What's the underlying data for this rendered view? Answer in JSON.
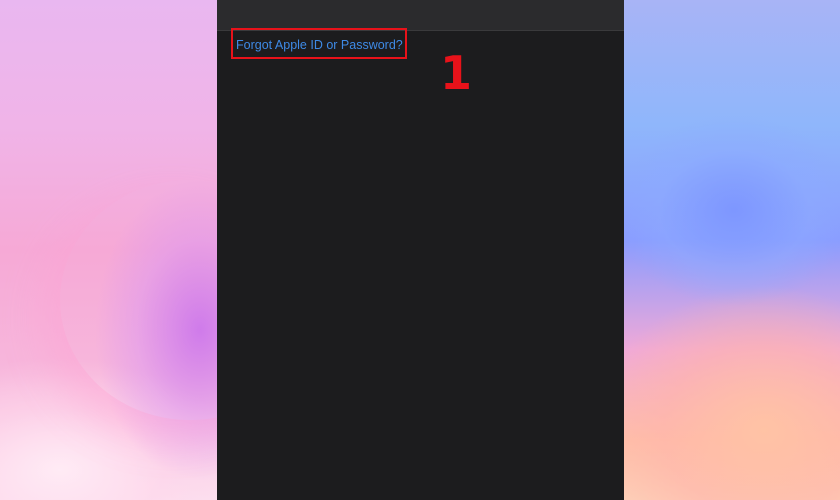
{
  "login_panel": {
    "forgot_link_label": "Forgot Apple ID or Password?"
  },
  "annotation": {
    "step_label": "1",
    "color": "#e8121a"
  },
  "colors": {
    "panel_background": "#1c1c1e",
    "top_bar_background": "#2b2b2d",
    "link": "#3e8ae6"
  }
}
